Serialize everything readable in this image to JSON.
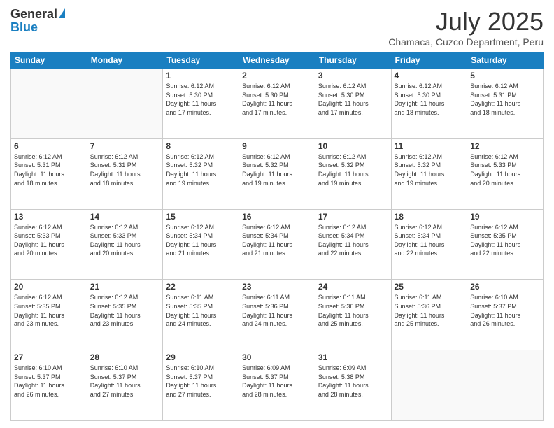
{
  "header": {
    "logo_general": "General",
    "logo_blue": "Blue",
    "month_year": "July 2025",
    "location": "Chamaca, Cuzco Department, Peru"
  },
  "weekdays": [
    "Sunday",
    "Monday",
    "Tuesday",
    "Wednesday",
    "Thursday",
    "Friday",
    "Saturday"
  ],
  "weeks": [
    [
      {
        "day": "",
        "info": ""
      },
      {
        "day": "",
        "info": ""
      },
      {
        "day": "1",
        "info": "Sunrise: 6:12 AM\nSunset: 5:30 PM\nDaylight: 11 hours\nand 17 minutes."
      },
      {
        "day": "2",
        "info": "Sunrise: 6:12 AM\nSunset: 5:30 PM\nDaylight: 11 hours\nand 17 minutes."
      },
      {
        "day": "3",
        "info": "Sunrise: 6:12 AM\nSunset: 5:30 PM\nDaylight: 11 hours\nand 17 minutes."
      },
      {
        "day": "4",
        "info": "Sunrise: 6:12 AM\nSunset: 5:30 PM\nDaylight: 11 hours\nand 18 minutes."
      },
      {
        "day": "5",
        "info": "Sunrise: 6:12 AM\nSunset: 5:31 PM\nDaylight: 11 hours\nand 18 minutes."
      }
    ],
    [
      {
        "day": "6",
        "info": "Sunrise: 6:12 AM\nSunset: 5:31 PM\nDaylight: 11 hours\nand 18 minutes."
      },
      {
        "day": "7",
        "info": "Sunrise: 6:12 AM\nSunset: 5:31 PM\nDaylight: 11 hours\nand 18 minutes."
      },
      {
        "day": "8",
        "info": "Sunrise: 6:12 AM\nSunset: 5:32 PM\nDaylight: 11 hours\nand 19 minutes."
      },
      {
        "day": "9",
        "info": "Sunrise: 6:12 AM\nSunset: 5:32 PM\nDaylight: 11 hours\nand 19 minutes."
      },
      {
        "day": "10",
        "info": "Sunrise: 6:12 AM\nSunset: 5:32 PM\nDaylight: 11 hours\nand 19 minutes."
      },
      {
        "day": "11",
        "info": "Sunrise: 6:12 AM\nSunset: 5:32 PM\nDaylight: 11 hours\nand 19 minutes."
      },
      {
        "day": "12",
        "info": "Sunrise: 6:12 AM\nSunset: 5:33 PM\nDaylight: 11 hours\nand 20 minutes."
      }
    ],
    [
      {
        "day": "13",
        "info": "Sunrise: 6:12 AM\nSunset: 5:33 PM\nDaylight: 11 hours\nand 20 minutes."
      },
      {
        "day": "14",
        "info": "Sunrise: 6:12 AM\nSunset: 5:33 PM\nDaylight: 11 hours\nand 20 minutes."
      },
      {
        "day": "15",
        "info": "Sunrise: 6:12 AM\nSunset: 5:34 PM\nDaylight: 11 hours\nand 21 minutes."
      },
      {
        "day": "16",
        "info": "Sunrise: 6:12 AM\nSunset: 5:34 PM\nDaylight: 11 hours\nand 21 minutes."
      },
      {
        "day": "17",
        "info": "Sunrise: 6:12 AM\nSunset: 5:34 PM\nDaylight: 11 hours\nand 22 minutes."
      },
      {
        "day": "18",
        "info": "Sunrise: 6:12 AM\nSunset: 5:34 PM\nDaylight: 11 hours\nand 22 minutes."
      },
      {
        "day": "19",
        "info": "Sunrise: 6:12 AM\nSunset: 5:35 PM\nDaylight: 11 hours\nand 22 minutes."
      }
    ],
    [
      {
        "day": "20",
        "info": "Sunrise: 6:12 AM\nSunset: 5:35 PM\nDaylight: 11 hours\nand 23 minutes."
      },
      {
        "day": "21",
        "info": "Sunrise: 6:12 AM\nSunset: 5:35 PM\nDaylight: 11 hours\nand 23 minutes."
      },
      {
        "day": "22",
        "info": "Sunrise: 6:11 AM\nSunset: 5:35 PM\nDaylight: 11 hours\nand 24 minutes."
      },
      {
        "day": "23",
        "info": "Sunrise: 6:11 AM\nSunset: 5:36 PM\nDaylight: 11 hours\nand 24 minutes."
      },
      {
        "day": "24",
        "info": "Sunrise: 6:11 AM\nSunset: 5:36 PM\nDaylight: 11 hours\nand 25 minutes."
      },
      {
        "day": "25",
        "info": "Sunrise: 6:11 AM\nSunset: 5:36 PM\nDaylight: 11 hours\nand 25 minutes."
      },
      {
        "day": "26",
        "info": "Sunrise: 6:10 AM\nSunset: 5:37 PM\nDaylight: 11 hours\nand 26 minutes."
      }
    ],
    [
      {
        "day": "27",
        "info": "Sunrise: 6:10 AM\nSunset: 5:37 PM\nDaylight: 11 hours\nand 26 minutes."
      },
      {
        "day": "28",
        "info": "Sunrise: 6:10 AM\nSunset: 5:37 PM\nDaylight: 11 hours\nand 27 minutes."
      },
      {
        "day": "29",
        "info": "Sunrise: 6:10 AM\nSunset: 5:37 PM\nDaylight: 11 hours\nand 27 minutes."
      },
      {
        "day": "30",
        "info": "Sunrise: 6:09 AM\nSunset: 5:37 PM\nDaylight: 11 hours\nand 28 minutes."
      },
      {
        "day": "31",
        "info": "Sunrise: 6:09 AM\nSunset: 5:38 PM\nDaylight: 11 hours\nand 28 minutes."
      },
      {
        "day": "",
        "info": ""
      },
      {
        "day": "",
        "info": ""
      }
    ]
  ]
}
